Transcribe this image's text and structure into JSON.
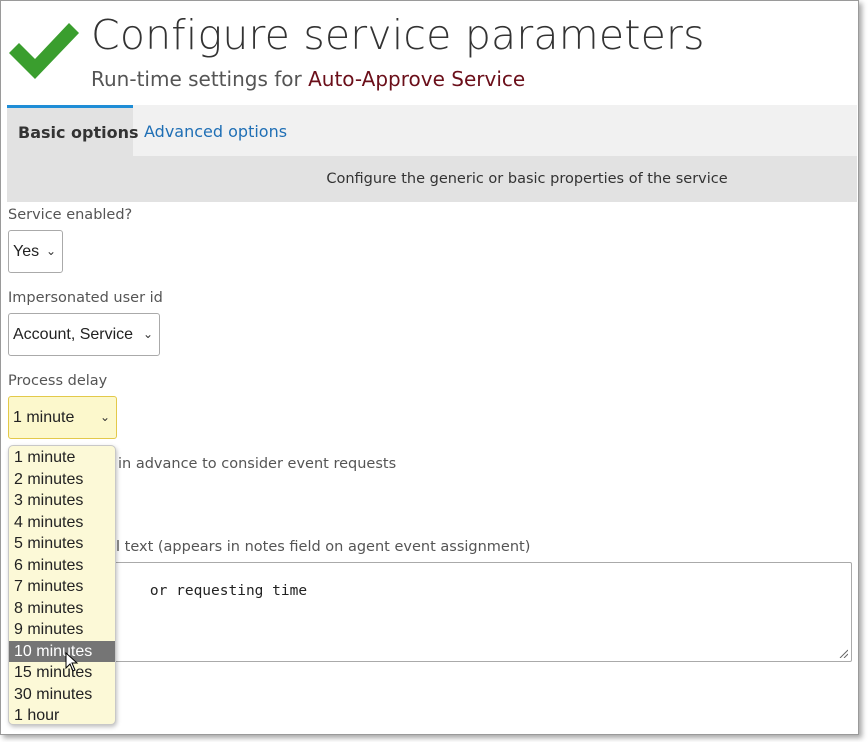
{
  "header": {
    "title": "Configure service parameters",
    "subtitle_prefix": "Run-time settings for ",
    "service_name": "Auto-Approve Service",
    "icon": "checkmark-icon",
    "accent_color": "#3a9e2e"
  },
  "tabs": [
    {
      "label": "Basic options",
      "active": true
    },
    {
      "label": "Advanced options",
      "active": false
    }
  ],
  "description": "Configure the generic or basic properties of the service",
  "fields": {
    "service_enabled": {
      "label": "Service enabled?",
      "value": "Yes"
    },
    "impersonated_user": {
      "label": "Impersonated user id",
      "value": "Account, Service"
    },
    "process_delay": {
      "label": "Process delay",
      "value": "1 minute"
    },
    "advance_label_partial": "in advance to consider event requests",
    "note_label_partial": "l text (appears in notes field on agent event assignment)",
    "note_text_partial": "or requesting time"
  },
  "dropdown": {
    "options": [
      "1 minute",
      "2 minutes",
      "3 minutes",
      "4 minutes",
      "5 minutes",
      "6 minutes",
      "7 minutes",
      "8 minutes",
      "9 minutes",
      "10 minutes",
      "15 minutes",
      "30 minutes",
      "1 hour"
    ],
    "highlighted_index": 9
  }
}
